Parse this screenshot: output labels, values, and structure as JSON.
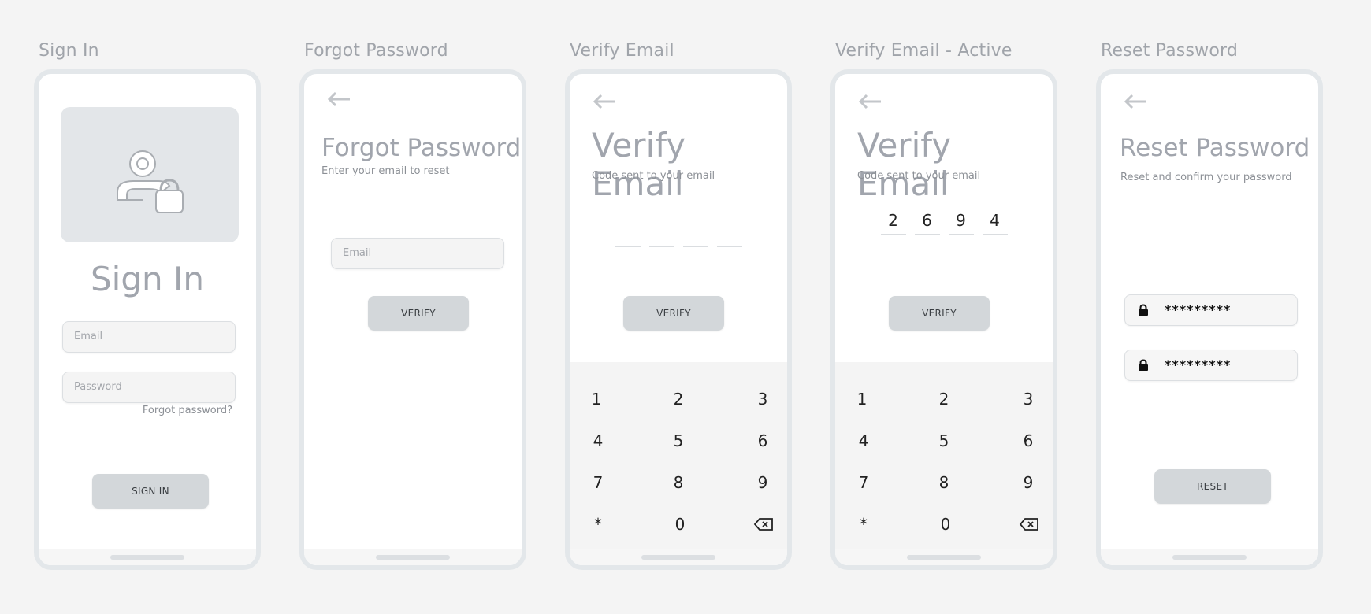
{
  "frames": {
    "sign_in": "Sign In",
    "forgot_password": "Forgot Password",
    "verify_email": "Verify Email",
    "verify_email_active": "Verify Email - Active",
    "reset_password": "Reset Password"
  },
  "sign_in": {
    "title": "Sign In",
    "email_placeholder": "Email",
    "password_placeholder": "Password",
    "forgot_link": "Forgot password?",
    "button": "SIGN IN"
  },
  "forgot_password": {
    "title": "Forgot Password",
    "subtitle": "Enter your email to reset",
    "email_placeholder": "Email",
    "button": "VERIFY"
  },
  "verify_email": {
    "title": "Verify Email",
    "subtitle": "Code sent to your email",
    "code": [
      "",
      "",
      "",
      ""
    ],
    "button": "VERIFY"
  },
  "verify_email_active": {
    "title": "Verify Email",
    "subtitle": "Code sent to your email",
    "code": [
      "2",
      "6",
      "9",
      "4"
    ],
    "button": "VERIFY"
  },
  "keypad": {
    "keys": [
      "1",
      "2",
      "3",
      "4",
      "5",
      "6",
      "7",
      "8",
      "9",
      "*",
      "0"
    ],
    "backspace_icon": "backspace-icon"
  },
  "reset_password": {
    "title": "Reset Password",
    "subtitle": "Reset and confirm your password",
    "password_mask": "*********",
    "confirm_mask": "*********",
    "button": "RESET"
  },
  "colors": {
    "background": "#f4f4f4",
    "phone_border": "#e3e7ea",
    "button": "#d3d7da",
    "title_gray": "#a1a5ad"
  }
}
